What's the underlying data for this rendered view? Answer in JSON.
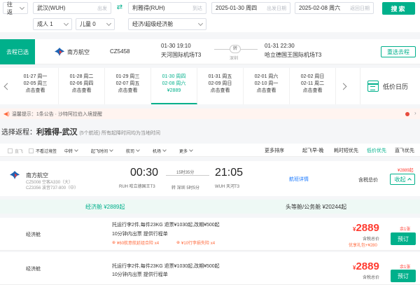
{
  "search": {
    "trip_type": "往返",
    "from_city": "武汉(WUH)",
    "from_hint": "出发",
    "to_city": "利雅得(RUH)",
    "to_hint": "到达",
    "depart_date": "2025-01-30 周四",
    "depart_hint": "出发日期",
    "return_date": "2025-02-08 周六",
    "return_hint": "返回日期",
    "adults": "成人 1",
    "children": "儿童 0",
    "cabin": "经济/超级经济舱",
    "search_label": "搜索"
  },
  "outbound": {
    "tag": "去程已选",
    "airline": "南方航空",
    "flight_no": "CZ5458",
    "dep_time": "01-30 19:10",
    "dep_airport": "天河国际机场T3",
    "stop": "转",
    "stop_city": "深圳",
    "arr_time": "01-31 22:30",
    "arr_airport": "哈立德国王国际机场T3",
    "reselect_label": "重选去程"
  },
  "dates": [
    {
      "d1": "01-27 周一",
      "d2": "02-05 周三",
      "price": "点击查看"
    },
    {
      "d1": "01-28 周二",
      "d2": "02-06 周四",
      "price": "点击查看"
    },
    {
      "d1": "01-29 周三",
      "d2": "02-07 周五",
      "price": "点击查看"
    },
    {
      "d1": "01-30 周四",
      "d2": "02-08 周六",
      "price": "¥2889"
    },
    {
      "d1": "01-31 周五",
      "d2": "02-09 周日",
      "price": "点击查看"
    },
    {
      "d1": "02-01 周六",
      "d2": "02-10 周一",
      "price": "点击查看"
    },
    {
      "d1": "02-02 周日",
      "d2": "02-11 周二",
      "price": "点击查看"
    }
  ],
  "calendar_label": "低价日历",
  "notice": {
    "icon": "speaker-icon",
    "text": "温馨提示：1条公告 · 沙特阿拉伯入境提醒"
  },
  "return_title": {
    "prefix": "选择返程：",
    "route": "利雅得-武汉",
    "sub": "(5个航班) 所有起降时间均为当地时间"
  },
  "filters": {
    "direct_only": "直飞",
    "hide_shared": "不看过境签",
    "transfer": "中转",
    "dep_time": "起飞时间",
    "airline": "航司",
    "airport": "机场",
    "more": "更多",
    "more_sort": "更多排序",
    "sort_dep": "起飞早-晚",
    "sort_duration": "耗时短优先",
    "sort_price": "低价优先",
    "sort_direct": "直飞优先"
  },
  "flight": {
    "airline": "南方航空",
    "plane1": "CZ5008 空客A330（大）",
    "plane2": "CZ3356 波音737-800（中）",
    "dep_time": "00:30",
    "dep_airport": "RUH 哈立德国王T3",
    "duration": "15时35分",
    "stop": "转 深圳 5时5分",
    "arr_time": "21:05",
    "arr_airport": "WUH 天河T3",
    "detail_label": "航班详情",
    "tax_label": "含税总价",
    "price_start": "¥2889起",
    "collapse_label": "收起"
  },
  "cabins": {
    "economy": "经济舱 ¥2889起",
    "first": "头等舱/公务舱 ¥20244起"
  },
  "fares": [
    {
      "cls": "经济舱",
      "line1": "托运行李2件,每件23KG   退票¥1030起,改期¥500起",
      "line2": "10分钟内出票   提供行程单",
      "tags": [
        "¥60航意航延组合险  x4",
        "¥10行李损失险  x4"
      ],
      "price": "2889",
      "tax": "含税总价",
      "hint": "优享礼包+¥280",
      "left": "余1张",
      "book": "预订"
    },
    {
      "cls": "经济舱",
      "line1": "托运行李2件,每件23KG   退票¥1030起,改期¥500起",
      "line2": "10分钟内出票   提供行程单",
      "price": "2889",
      "tax": "含税总价",
      "left": "余1张",
      "book": "预订"
    }
  ],
  "colors": {
    "accent": "#00b08b",
    "price": "#ff3b30",
    "link": "#1677ff"
  }
}
